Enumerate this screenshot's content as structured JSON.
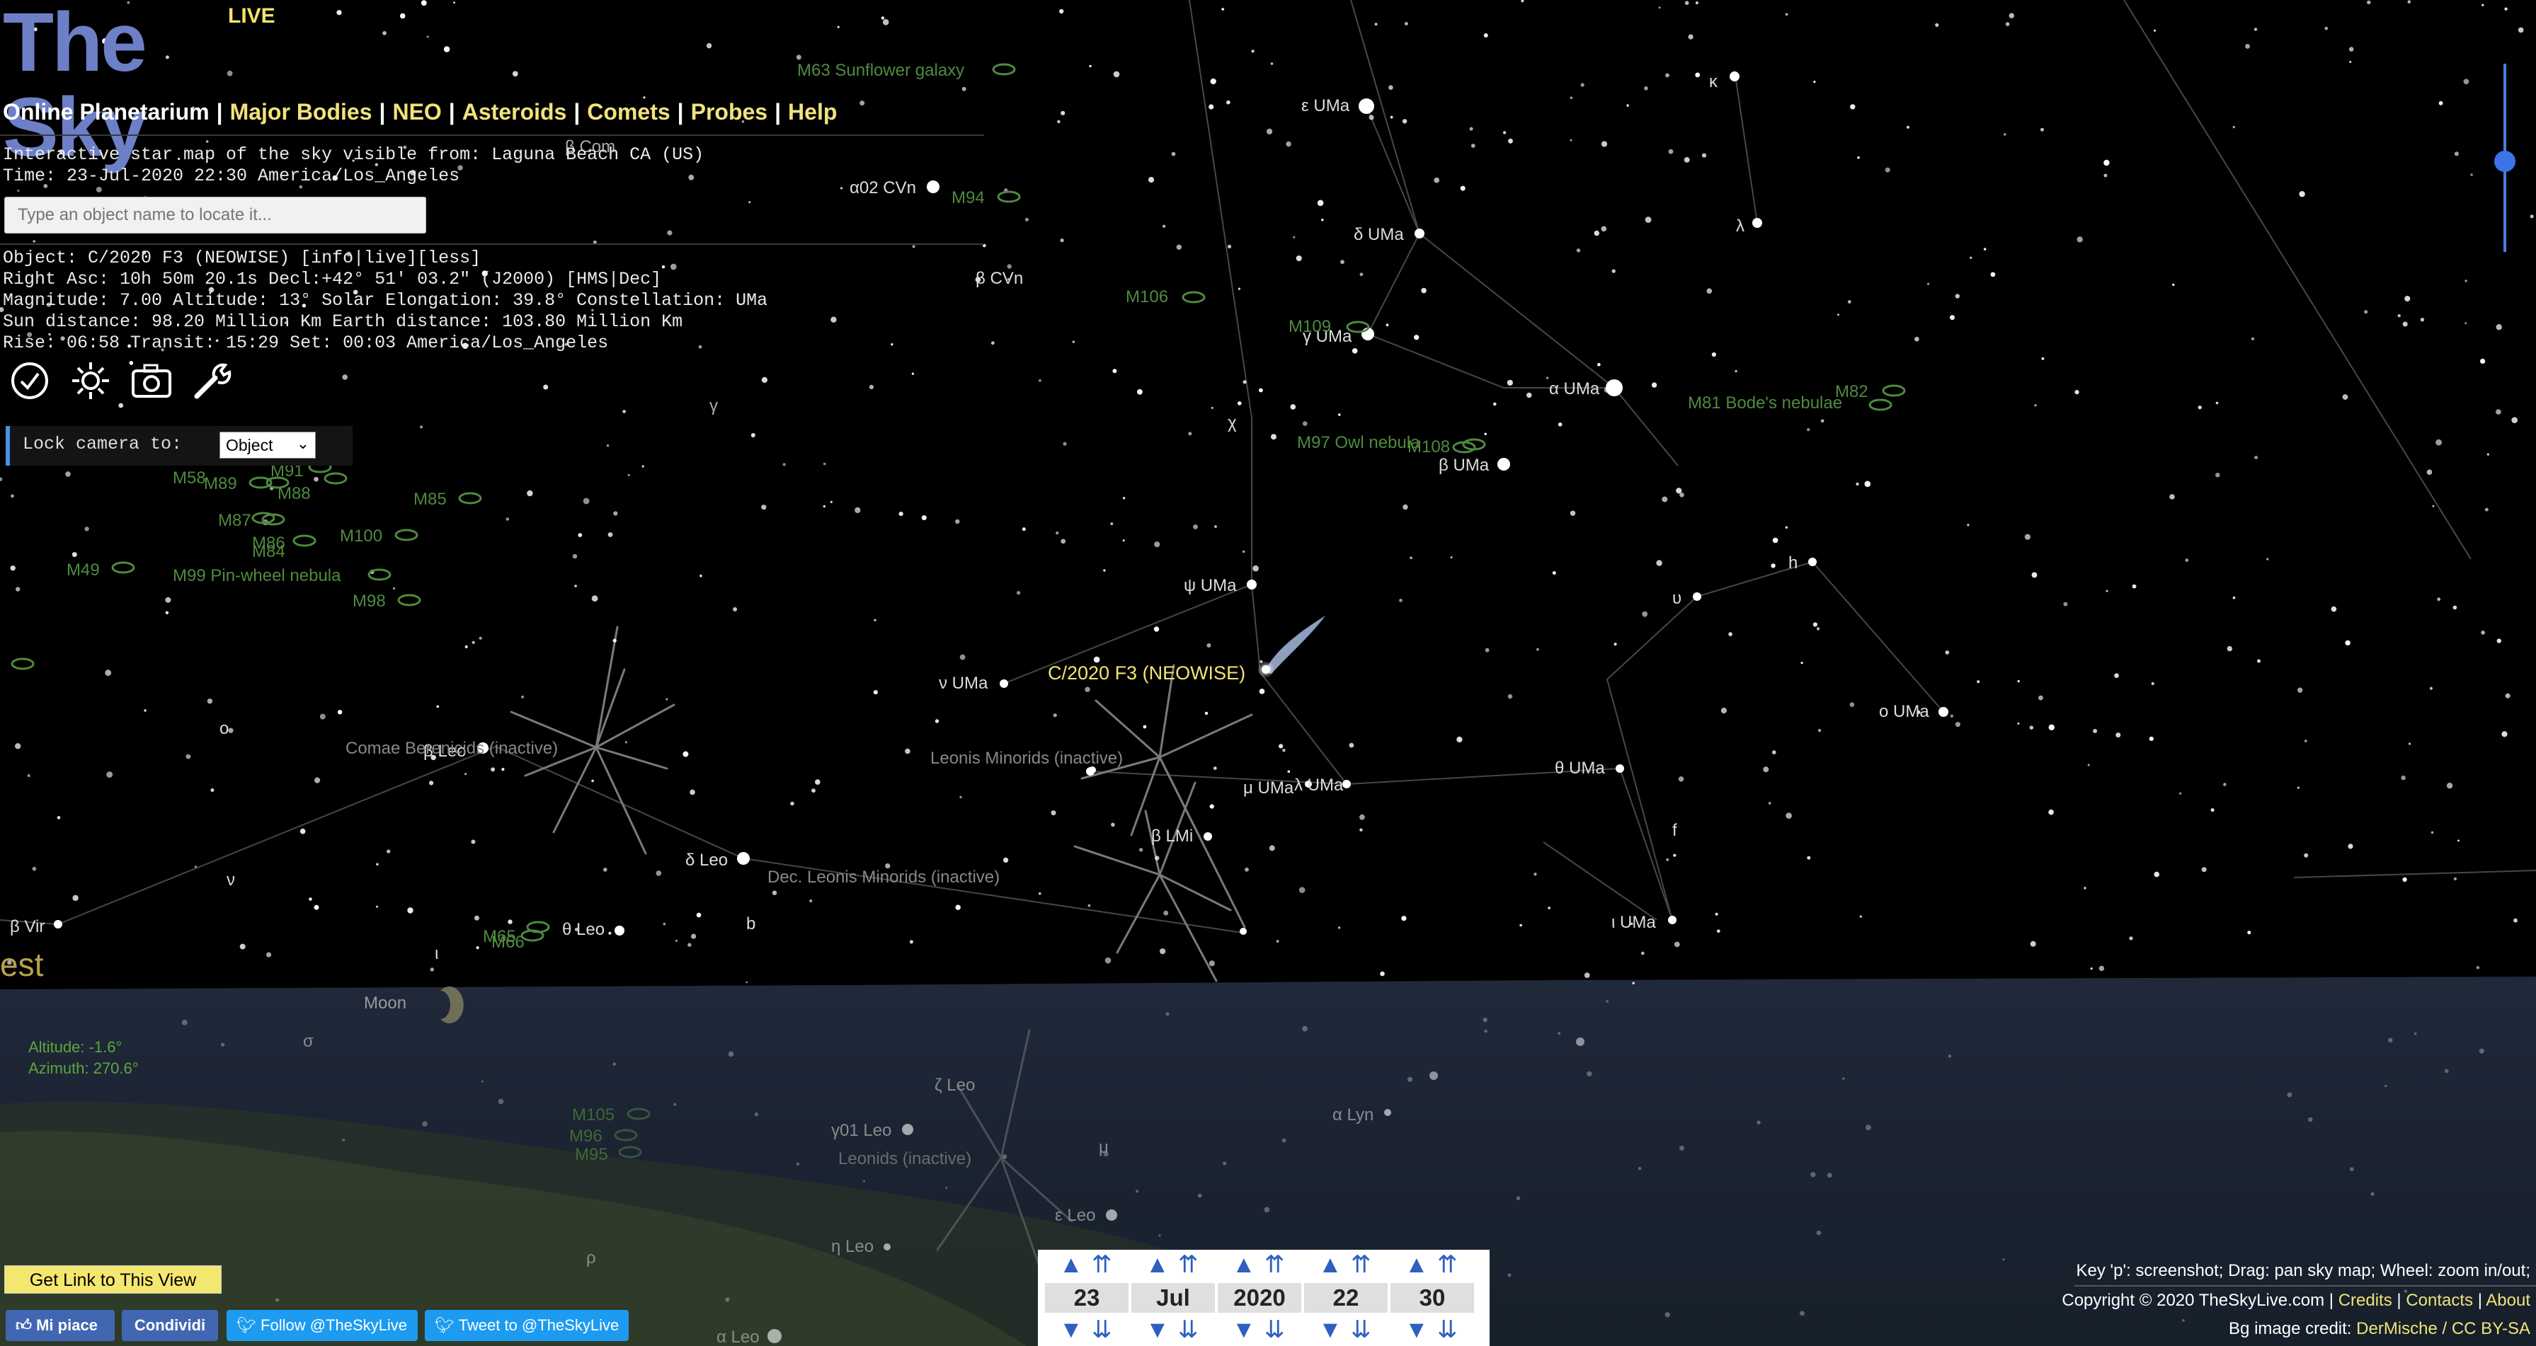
{
  "header": {
    "logo_main": "The Sky",
    "logo_badge": "LIVE",
    "nav_first": "Online Planetarium",
    "nav_items": [
      "Major Bodies",
      "NEO",
      "Asteroids",
      "Comets",
      "Probes",
      "Help"
    ]
  },
  "intro": {
    "line1": "Interactive star map of the sky visible from: Laguna Beach CA (US)",
    "line2": "Time: 23-Jul-2020 22:30 America/Los_Angeles"
  },
  "search": {
    "placeholder": "Type an object name to locate it..."
  },
  "object_info": {
    "line1": "Object: C/2020 F3 (NEOWISE) [info|live][less]",
    "line2": "Right Asc: 10h 50m 20.1s Decl:+42° 51' 03.2\" (J2000) [HMS|Dec]",
    "line3": "Magnitude: 7.00 Altitude: 13° Solar Elongation: 39.8° Constellation: UMa",
    "line4": "Sun distance: 98.20 Million Km Earth distance: 103.80 Million Km",
    "line5": "Rise: 06:58 Transit: 15:29 Set: 00:03 America/Los_Angeles"
  },
  "tools": [
    {
      "name": "clock-icon"
    },
    {
      "name": "sun-icon"
    },
    {
      "name": "camera-icon"
    },
    {
      "name": "wrench-icon"
    }
  ],
  "lock": {
    "label": "Lock camera to:",
    "value": "Object"
  },
  "comet_label": "C/2020 F3 (NEOWISE)",
  "sky_labels": {
    "eps_uma": "ε UMa",
    "delta_uma": "δ UMa",
    "gamma_uma": "γ UMa",
    "alpha_uma": "α UMa",
    "beta_uma": "β UMa",
    "psi_uma": "ψ UMa",
    "nu_uma": "ν UMa",
    "mu_uma": "μ UMa",
    "lambda_uma": "λ UMa",
    "theta_uma": "θ UMa",
    "omicron_uma": "ο UMa",
    "iota_uma": "ι UMa",
    "kappa": "κ",
    "lambda": "λ",
    "chi": "χ",
    "upsilon": "υ",
    "h": "h",
    "f": "f",
    "beta_lmi": "β LMi",
    "alpha02_cvn": "α02 CVn",
    "beta_cvn": "β CVn",
    "beta_com": "β Com",
    "gamma": "γ",
    "o": "o",
    "nu": "ν",
    "b": "b",
    "iota": "ι",
    "beta_vir": "β Vir",
    "beta_leo": "β Leo",
    "delta_leo": "δ Leo",
    "theta_leo": "θ Leo",
    "zeta_leo": "ζ Leo",
    "gamma01_leo": "γ01 Leo",
    "eps_leo": "ε Leo",
    "eta_leo": "η Leo",
    "alpha_leo": "α Leo",
    "alpha_lyn": "α Lyn",
    "mu": "μ",
    "sigma": "σ",
    "rho": "ρ",
    "moon": "Moon",
    "west": "est",
    "m63": "M63 Sunflower galaxy",
    "m94": "M94",
    "m106": "M106",
    "m109": "M109",
    "m97": "M97 Owl nebula",
    "m108": "M108",
    "m81": "M81 Bode's nebulae",
    "m82": "M82",
    "m85": "M85",
    "m88": "M88",
    "m87": "M87",
    "m100": "M100",
    "m86": "M86",
    "m84": "M84",
    "m49": "M49",
    "m99": "M99 Pin-wheel nebula",
    "m98": "M98",
    "m90": "M90",
    "m58": "M58",
    "m89": "M89",
    "m91": "M91",
    "m65": "M65",
    "m66": "M66",
    "m105": "M105",
    "m96": "M96",
    "m95": "M95",
    "shower_comae": "Comae Berenicids (inactive)",
    "shower_lmi": "Leonis Minorids (inactive)",
    "shower_dec_lmi": "Dec. Leonis Minorids (inactive)",
    "shower_leonids": "Leonids (inactive)"
  },
  "hud": {
    "altitude": "Altitude: -1.6°",
    "azimuth": "Azimuth: 270.6°"
  },
  "bottom": {
    "get_link": "Get Link to This View",
    "fb_like": "Mi piace",
    "fb_share": "Condividi",
    "tw_follow": "Follow @TheSkyLive",
    "tw_tweet": "Tweet to @TheSkyLive"
  },
  "date": {
    "day": "23",
    "month": "Jul",
    "year": "2020",
    "hour": "22",
    "minute": "30"
  },
  "footer": {
    "keys": "Key 'p': screenshot; Drag: pan sky map; Wheel: zoom in/out;",
    "copyright": "Copyright © 2020 TheSkyLive.com |",
    "credits": "Credits",
    "contacts": "Contacts",
    "about": "About",
    "bg_credit": "Bg image credit:",
    "bg_author": "DerMische / CC BY-SA"
  },
  "colors": {
    "sky": "#000000",
    "ground": "#1c2433",
    "star": "#ffffff",
    "dso": "#4f8a3f",
    "constellation_line": "#4a4a4a",
    "comet_label": "#f3e56b",
    "logo": "#6d7fc6",
    "nav_link": "#f1e37a"
  }
}
